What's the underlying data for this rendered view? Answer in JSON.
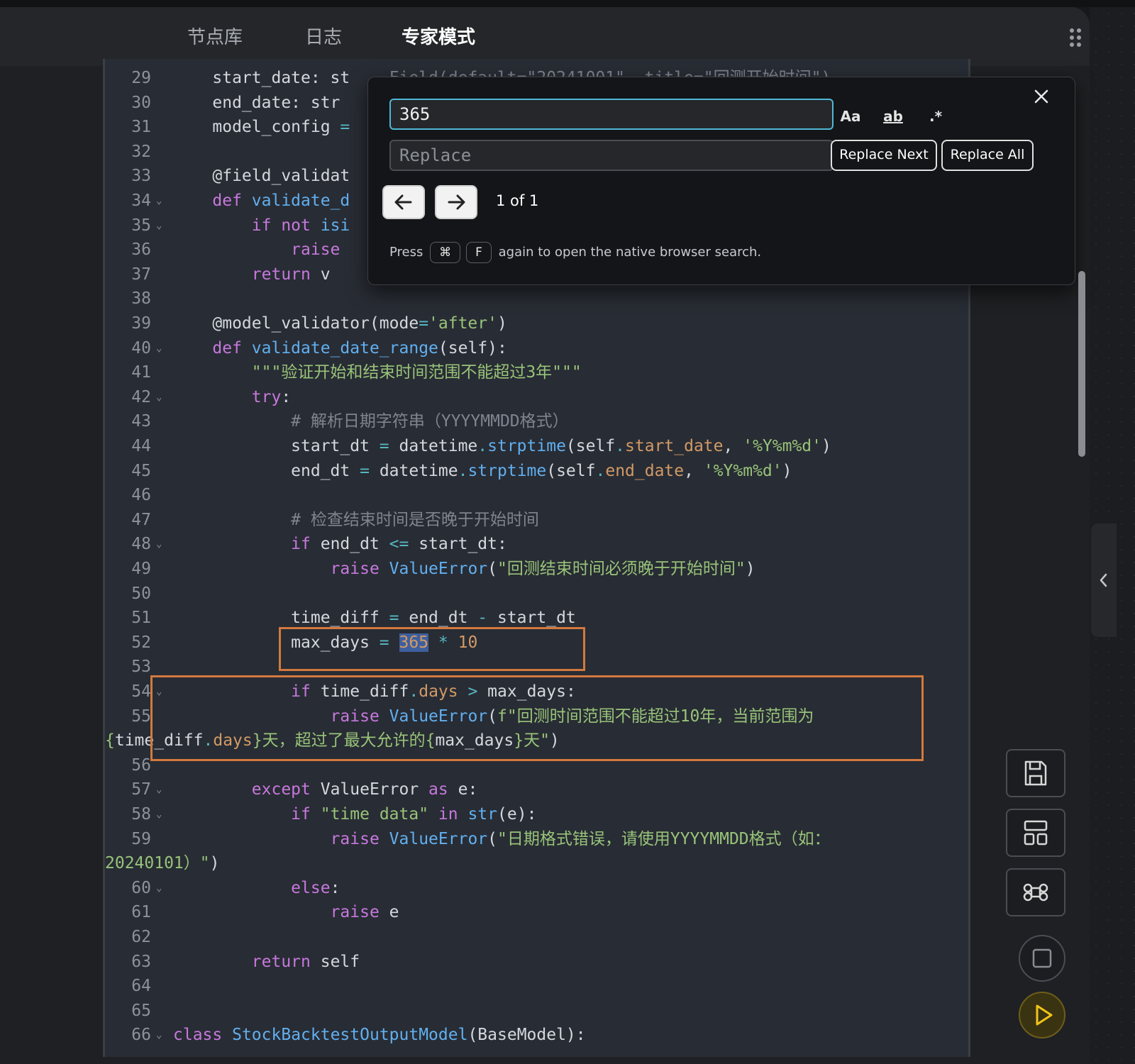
{
  "tabs": [
    {
      "label": "节点库",
      "active": false
    },
    {
      "label": "日志",
      "active": false
    },
    {
      "label": "专家模式",
      "active": true
    }
  ],
  "code_lines": [
    {
      "n": "29",
      "fold": false,
      "html": "    start_date: st<span class=\"c\">    Field(default=\"20241001\", title=\"回测开始时间\")</span>"
    },
    {
      "n": "30",
      "fold": false,
      "html": "    end_date: str"
    },
    {
      "n": "31",
      "fold": false,
      "html": "    model_config <span class=\"o\">=</span>"
    },
    {
      "n": "32",
      "fold": false,
      "html": ""
    },
    {
      "n": "33",
      "fold": false,
      "html": "    @field_validat"
    },
    {
      "n": "34",
      "fold": true,
      "html": "    <span class=\"k\">def</span> <span class=\"f\">validate_d</span>"
    },
    {
      "n": "35",
      "fold": true,
      "html": "        <span class=\"k\">if not</span> <span class=\"f\">isi</span>"
    },
    {
      "n": "36",
      "fold": false,
      "html": "            <span class=\"k\">raise</span>"
    },
    {
      "n": "37",
      "fold": false,
      "html": "        <span class=\"k\">return</span> v"
    },
    {
      "n": "38",
      "fold": false,
      "html": ""
    },
    {
      "n": "39",
      "fold": false,
      "html": "    @model_validator(mode<span class=\"o\">=</span><span class=\"s\">'after'</span>)"
    },
    {
      "n": "40",
      "fold": true,
      "html": "    <span class=\"k\">def</span> <span class=\"f\">validate_date_range</span>(self):"
    },
    {
      "n": "41",
      "fold": false,
      "html": "        <span class=\"s\">\"\"\"验证开始和结束时间范围不能超过3年\"\"\"</span>"
    },
    {
      "n": "42",
      "fold": true,
      "html": "        <span class=\"k\">try</span>:"
    },
    {
      "n": "43",
      "fold": false,
      "html": "            <span class=\"c\"># 解析日期字符串（YYYYMMDD格式）</span>"
    },
    {
      "n": "44",
      "fold": false,
      "html": "            start_dt <span class=\"o\">=</span> datetime<span class=\"o\">.</span><span class=\"f\">strptime</span>(self<span class=\"o\">.</span><span class=\"n\">start_date</span>, <span class=\"s\">'%Y%m%d'</span>)"
    },
    {
      "n": "45",
      "fold": false,
      "html": "            end_dt <span class=\"o\">=</span> datetime<span class=\"o\">.</span><span class=\"f\">strptime</span>(self<span class=\"o\">.</span><span class=\"n\">end_date</span>, <span class=\"s\">'%Y%m%d'</span>)"
    },
    {
      "n": "46",
      "fold": false,
      "html": ""
    },
    {
      "n": "47",
      "fold": false,
      "html": "            <span class=\"c\"># 检查结束时间是否晚于开始时间</span>"
    },
    {
      "n": "48",
      "fold": true,
      "html": "            <span class=\"k\">if</span> end_dt <span class=\"o\">&lt;=</span> start_dt:"
    },
    {
      "n": "49",
      "fold": false,
      "html": "                <span class=\"k\">raise</span> <span class=\"f\">ValueError</span>(<span class=\"s\">\"回测结束时间必须晚于开始时间\"</span>)"
    },
    {
      "n": "50",
      "fold": false,
      "html": ""
    },
    {
      "n": "51",
      "fold": false,
      "html": "            time_diff <span class=\"o\">=</span> end_dt <span class=\"o\">-</span> start_dt"
    },
    {
      "n": "52",
      "fold": false,
      "html": "            max_days <span class=\"o\">=</span> <span class=\"hl\">365</span> <span class=\"o\">*</span> <span class=\"n\">10</span>"
    },
    {
      "n": "53",
      "fold": false,
      "html": ""
    },
    {
      "n": "54",
      "fold": true,
      "html": "            <span class=\"k\">if</span> time_diff<span class=\"o\">.</span><span class=\"n\">days</span> <span class=\"o\">&gt;</span> max_days:"
    },
    {
      "n": "55",
      "fold": false,
      "html": "                <span class=\"k\">raise</span> <span class=\"f\">ValueError</span>(<span class=\"s\">f\"回测时间范围不能超过10年，当前范围为</span>"
    },
    {
      "n": "",
      "fold": false,
      "html": "<span class=\"s\">{</span>time_diff<span class=\"o\">.</span><span class=\"n\">days</span><span class=\"s\">}天，超过了最大允许的{</span>max_days<span class=\"s\">}天\"</span>)"
    },
    {
      "n": "56",
      "fold": false,
      "html": ""
    },
    {
      "n": "57",
      "fold": true,
      "html": "        <span class=\"k\">except</span> ValueError <span class=\"k\">as</span> e:"
    },
    {
      "n": "58",
      "fold": true,
      "html": "            <span class=\"k\">if</span> <span class=\"s\">\"time data\"</span> <span class=\"k\">in</span> <span class=\"f\">str</span>(e):"
    },
    {
      "n": "59",
      "fold": false,
      "html": "                <span class=\"k\">raise</span> <span class=\"f\">ValueError</span>(<span class=\"s\">\"日期格式错误，请使用YYYYMMDD格式（如：</span>"
    },
    {
      "n": "",
      "fold": false,
      "html": "<span class=\"s\">20240101）\"</span>)"
    },
    {
      "n": "60",
      "fold": true,
      "html": "            <span class=\"k\">else</span>:"
    },
    {
      "n": "61",
      "fold": false,
      "html": "                <span class=\"k\">raise</span> e"
    },
    {
      "n": "62",
      "fold": false,
      "html": ""
    },
    {
      "n": "63",
      "fold": false,
      "html": "        <span class=\"k\">return</span> self"
    },
    {
      "n": "64",
      "fold": false,
      "html": ""
    },
    {
      "n": "65",
      "fold": false,
      "html": ""
    },
    {
      "n": "66",
      "fold": true,
      "html": "<span class=\"k\">class</span> <span class=\"f\">StockBacktestOutputModel</span>(BaseModel):"
    }
  ],
  "find": {
    "search_value": "365",
    "replace_placeholder": "Replace",
    "match_case_label": "Aa",
    "whole_word_label": "ab",
    "regex_label": ".*",
    "replace_next_label": "Replace Next",
    "replace_all_label": "Replace All",
    "counter": "1 of 1",
    "hint_press": "Press",
    "hint_key1": "⌘",
    "hint_key2": "F",
    "hint_rest": "again to open the native browser search."
  },
  "colors": {
    "accent": "#5b5fd6",
    "highlight_box": "#d2793e",
    "find_focus": "#4fb8d6"
  }
}
